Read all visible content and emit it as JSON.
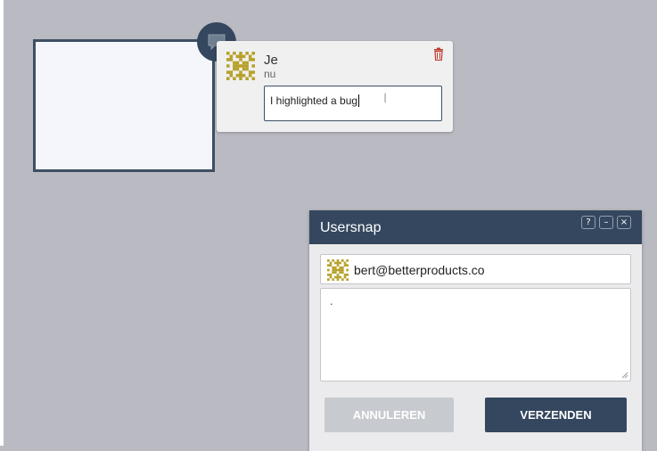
{
  "comment": {
    "author_initials": "Je",
    "time": "nu",
    "text": "I highlighted a bug"
  },
  "panel": {
    "title": "Usersnap",
    "help_label": "?",
    "minimize_label": "–",
    "close_label": "×",
    "email": "bert@betterproducts.co",
    "message": ".",
    "cancel_label": "ANNULEREN",
    "send_label": "VERZENDEN"
  },
  "colors": {
    "navy": "#34475e",
    "background": "#babac2",
    "trash_red": "#c0392b",
    "avatar_gold": "#b8a12a"
  },
  "icons": [
    "comment-bubble-icon",
    "trash-icon",
    "text-cursor-icon",
    "help-icon",
    "minimize-icon",
    "close-icon",
    "resize-handle-icon"
  ]
}
